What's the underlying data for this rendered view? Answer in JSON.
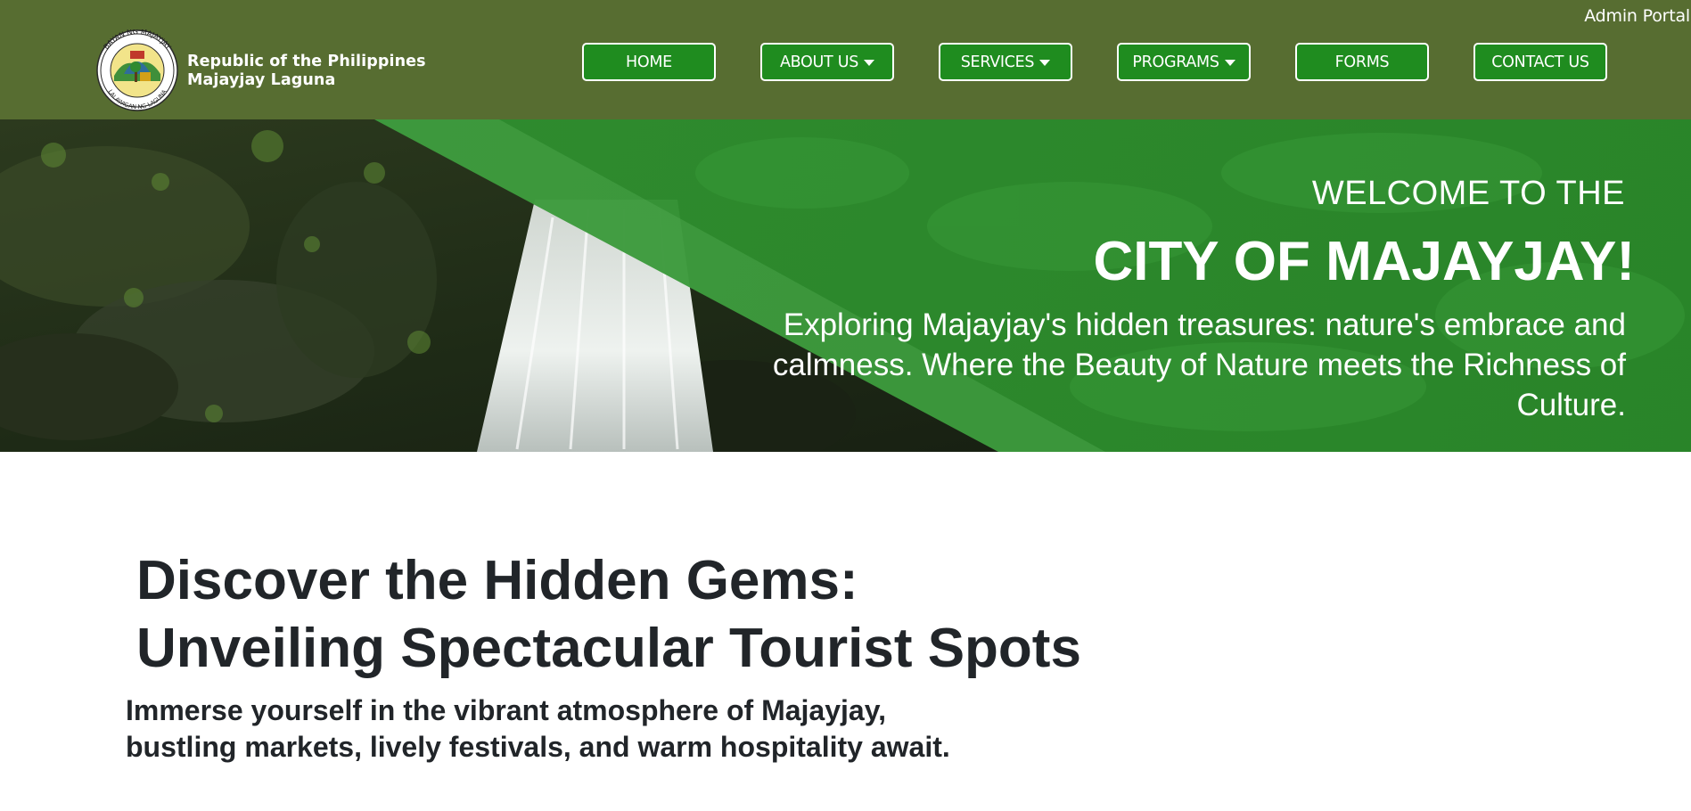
{
  "header": {
    "admin_label": "Admin Portal",
    "brand_line1": "Republic of the Philippines",
    "brand_line2": "Majayjay Laguna",
    "seal_text_top": "BAYAN NG MAJAYJAY",
    "seal_text_bottom": "LALAWIGAN NG LAGUNA",
    "background_color": "#576d31"
  },
  "nav": {
    "items": [
      {
        "label": "HOME",
        "dropdown": false
      },
      {
        "label": "ABOUT US",
        "dropdown": true
      },
      {
        "label": "SERVICES",
        "dropdown": true
      },
      {
        "label": "PROGRAMS",
        "dropdown": true
      },
      {
        "label": "FORMS",
        "dropdown": false
      },
      {
        "label": "CONTACT US",
        "dropdown": false
      }
    ],
    "button_color": "#1f8c1f"
  },
  "hero": {
    "welcome": "WELCOME TO THE",
    "city": "CITY OF MAJAYJAY!",
    "description": "Exploring Majayjay's hidden treasures: nature's embrace and calmness. Where the Beauty of Nature meets the Richness of Culture.",
    "overlay_color": "#1f8c1f"
  },
  "content": {
    "headline_line1": "Discover the Hidden Gems:",
    "headline_line2": "Unveiling Spectacular Tourist Spots",
    "subline_line1": "Immerse yourself in the vibrant atmosphere of Majayjay,",
    "subline_line2": "bustling markets, lively festivals, and warm hospitality await."
  }
}
